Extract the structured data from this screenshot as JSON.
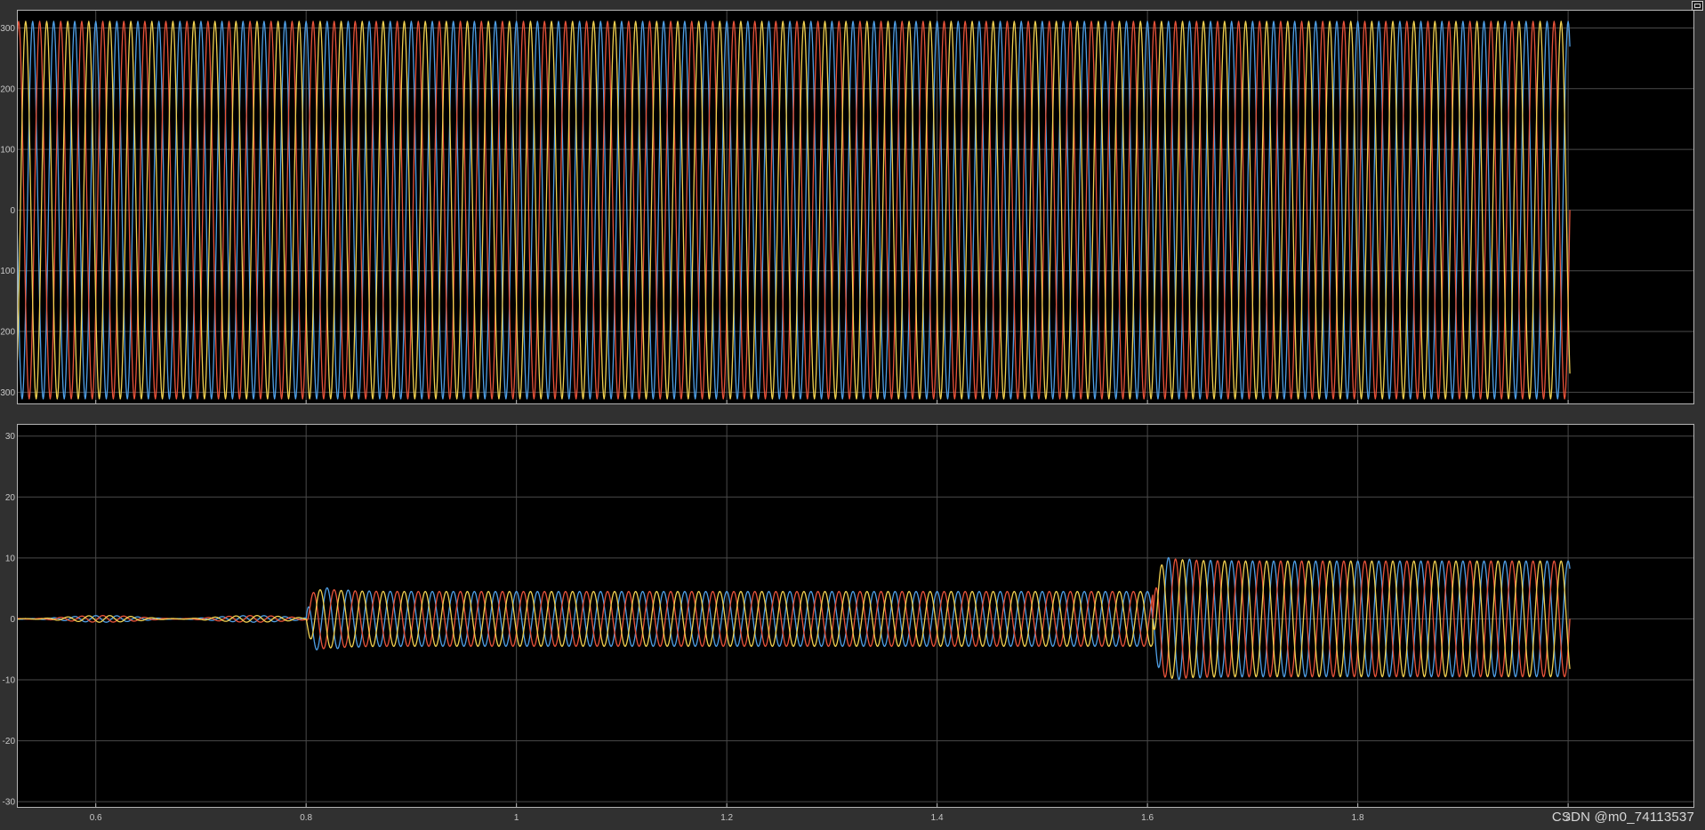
{
  "watermark": "CSDN @m0_74113537",
  "colors": {
    "background": "#000000",
    "frame": "#303030",
    "grid": "#4a4a4a",
    "axis_border": "#b5b5b5",
    "series": [
      "#4f9fe6",
      "#e8533a",
      "#f0d050"
    ]
  },
  "chart_data": [
    {
      "type": "line",
      "title": "",
      "xlabel": "",
      "ylabel": "",
      "xlim": [
        0.525,
        2.12
      ],
      "ylim": [
        -320,
        330
      ],
      "xticks": [
        0.6,
        0.8,
        1.0,
        1.2,
        1.4,
        1.6,
        1.8,
        2.0
      ],
      "xtick_labels": [
        "0.6",
        "0.8",
        "1",
        "1.2",
        "1.4",
        "1.6",
        "1.8",
        ""
      ],
      "yticks": [
        300,
        200,
        100,
        0,
        -100,
        -200,
        -300
      ],
      "ytick_labels": [
        "300",
        "200",
        "100",
        "0",
        "-100",
        "-200",
        "-300"
      ],
      "grid": true,
      "legend": "none",
      "frequency_hz": 50,
      "x_end": 2.002,
      "series": [
        {
          "color": "#4f9fe6",
          "phase_deg": 90,
          "segments": [
            {
              "from": 0.525,
              "to": 2.002,
              "amplitude": 311
            }
          ]
        },
        {
          "color": "#e8533a",
          "phase_deg": -30,
          "segments": [
            {
              "from": 0.525,
              "to": 2.002,
              "amplitude": 311
            }
          ]
        },
        {
          "color": "#f0d050",
          "phase_deg": 210,
          "segments": [
            {
              "from": 0.525,
              "to": 2.002,
              "amplitude": 311
            }
          ]
        }
      ]
    },
    {
      "type": "line",
      "title": "",
      "xlabel": "",
      "ylabel": "",
      "xlim": [
        0.525,
        2.12
      ],
      "ylim": [
        -31,
        32
      ],
      "xticks": [
        0.6,
        0.8,
        1.0,
        1.2,
        1.4,
        1.6,
        1.8,
        2.0
      ],
      "xtick_labels": [
        "0.6",
        "0.8",
        "1",
        "1.2",
        "1.4",
        "1.6",
        "1.8",
        "2"
      ],
      "yticks": [
        30,
        20,
        10,
        0,
        -10,
        -20,
        -30
      ],
      "ytick_labels": [
        "30",
        "20",
        "10",
        "0",
        "-10",
        "-20",
        "-30"
      ],
      "grid": true,
      "legend": "none",
      "frequency_hz": 50,
      "x_end": 2.002,
      "series": [
        {
          "color": "#4f9fe6",
          "phase_deg": 90,
          "segments": [
            {
              "from": 0.525,
              "to": 0.8,
              "amplitude": 0.3,
              "ripple": 0.25
            },
            {
              "from": 0.8,
              "to": 1.605,
              "amplitude": 4.5,
              "overshoot": 6.2
            },
            {
              "from": 1.605,
              "to": 2.002,
              "amplitude": 9.5,
              "overshoot": 11.2
            }
          ]
        },
        {
          "color": "#e8533a",
          "phase_deg": -30,
          "segments": [
            {
              "from": 0.525,
              "to": 0.8,
              "amplitude": 0.3,
              "ripple": 0.25
            },
            {
              "from": 0.8,
              "to": 1.605,
              "amplitude": 4.5,
              "overshoot": 5.6
            },
            {
              "from": 1.605,
              "to": 2.002,
              "amplitude": 9.5,
              "overshoot": 10.6
            }
          ]
        },
        {
          "color": "#f0d050",
          "phase_deg": 210,
          "segments": [
            {
              "from": 0.525,
              "to": 0.8,
              "amplitude": 0.3,
              "ripple": 0.25
            },
            {
              "from": 0.8,
              "to": 1.605,
              "amplitude": 4.5,
              "overshoot": 5.4
            },
            {
              "from": 1.605,
              "to": 2.002,
              "amplitude": 9.5,
              "overshoot": 10.4
            }
          ]
        }
      ]
    }
  ]
}
